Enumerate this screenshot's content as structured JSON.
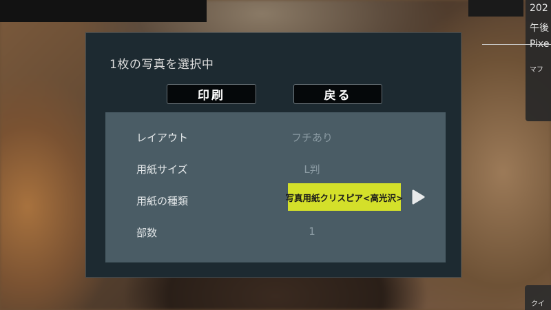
{
  "overlay": {
    "top_right_lines": [
      "202",
      "午後",
      "Pixe"
    ],
    "sub_label": "マフ",
    "bottom_right_label": "クイ"
  },
  "dialog": {
    "title": "1枚の写真を選択中",
    "print_button": "印刷",
    "back_button": "戻る",
    "settings": [
      {
        "label": "レイアウト",
        "value": "フチあり"
      },
      {
        "label": "用紙サイズ",
        "value": "L判"
      },
      {
        "label": "用紙の種類",
        "value": "写真用紙クリスピア<高光沢>",
        "selected": true
      },
      {
        "label": "部数",
        "value": "1"
      }
    ]
  },
  "colors": {
    "dialog_bg": "#1d2a31",
    "settings_bg": "#4a5c65",
    "highlight": "#d4e02a"
  }
}
